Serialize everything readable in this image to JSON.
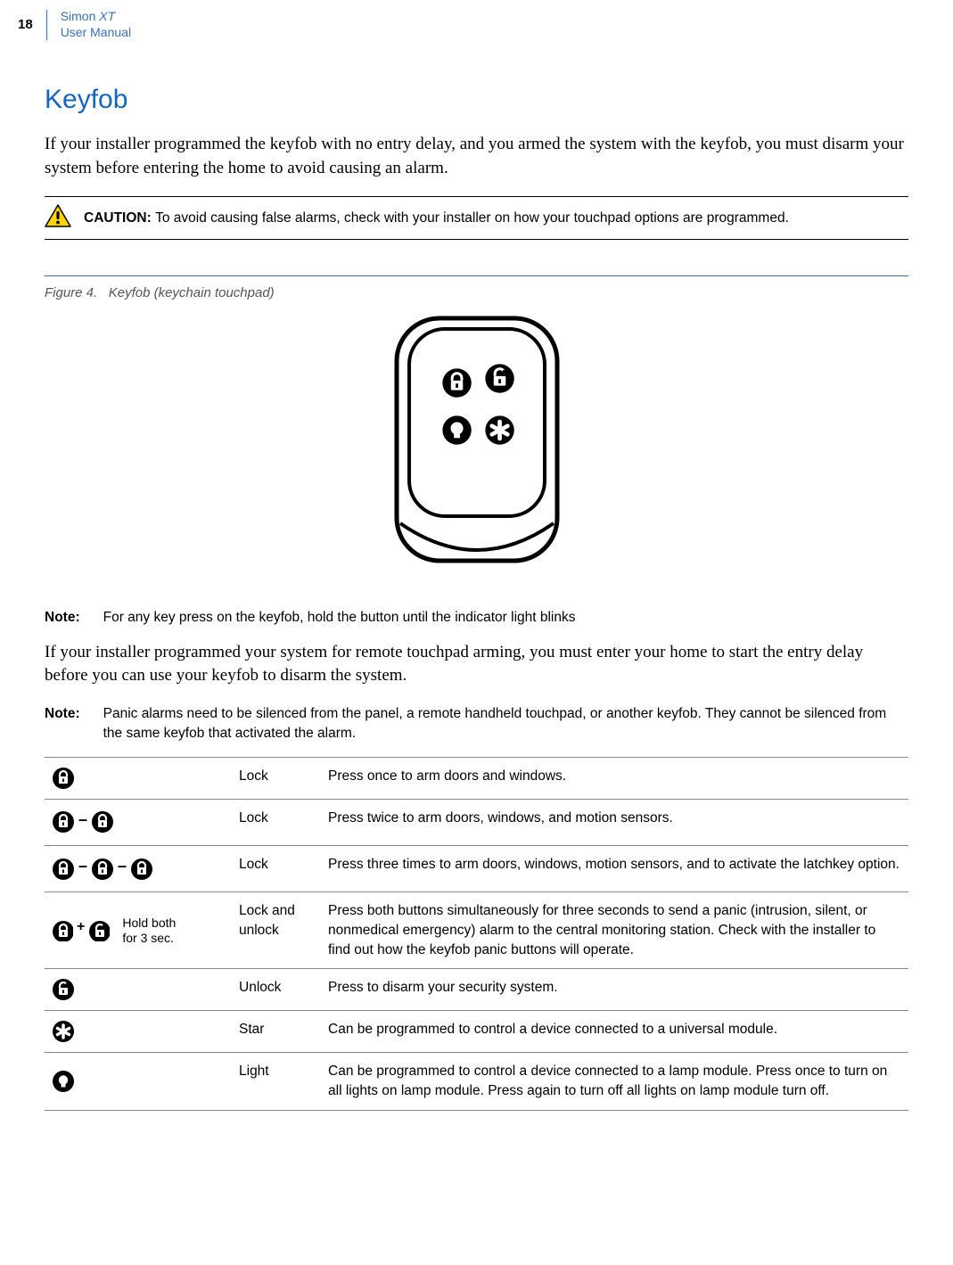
{
  "page_number": "18",
  "doc_title_line1": "Simon XT",
  "doc_title_line2": "User Manual",
  "section_heading": "Keyfob",
  "intro_paragraph": "If your installer programmed the keyfob with no entry delay, and you armed the system with the keyfob, you must disarm your system before entering the home to avoid causing an alarm.",
  "caution_label": "CAUTION:",
  "caution_text": "To avoid causing false alarms, check with your installer on how your touchpad options are programmed.",
  "figure_caption_prefix": "Figure 4.",
  "figure_caption": "Keyfob (keychain touchpad)",
  "note1_label": "Note:",
  "note1_text": "For any key press on the keyfob, hold the button until the indicator light blinks",
  "mid_paragraph": "If your installer programmed your system for remote touchpad arming, you must enter your home to start the entry delay before you can use your keyfob to disarm the system.",
  "note2_label": "Note:",
  "note2_text": "Panic alarms need to be silenced from the panel, a remote handheld touchpad, or another keyfob. They cannot be silenced from the same keyfob that activated the alarm.",
  "hold_text_line1": "Hold both",
  "hold_text_line2": "for 3 sec.",
  "table": [
    {
      "label": "Lock",
      "desc": "Press once to arm doors and windows."
    },
    {
      "label": "Lock",
      "desc": "Press twice to arm doors, windows, and motion sensors."
    },
    {
      "label": "Lock",
      "desc": "Press three times to arm doors, windows, motion sensors, and to activate the latchkey option."
    },
    {
      "label": "Lock and unlock",
      "desc": "Press both buttons simultaneously for three seconds to send a panic (intrusion, silent, or nonmedical emergency) alarm to the central monitoring station. Check with the installer to find out how the keyfob panic buttons will operate."
    },
    {
      "label": "Unlock",
      "desc": "Press to disarm your security system."
    },
    {
      "label": "Star",
      "desc": "Can be programmed to control a device connected to a universal module."
    },
    {
      "label": "Light",
      "desc": "Can be programmed to control a device connected to a lamp module. Press once to turn on all lights on lamp module. Press again to turn off all lights on lamp module turn off."
    }
  ]
}
